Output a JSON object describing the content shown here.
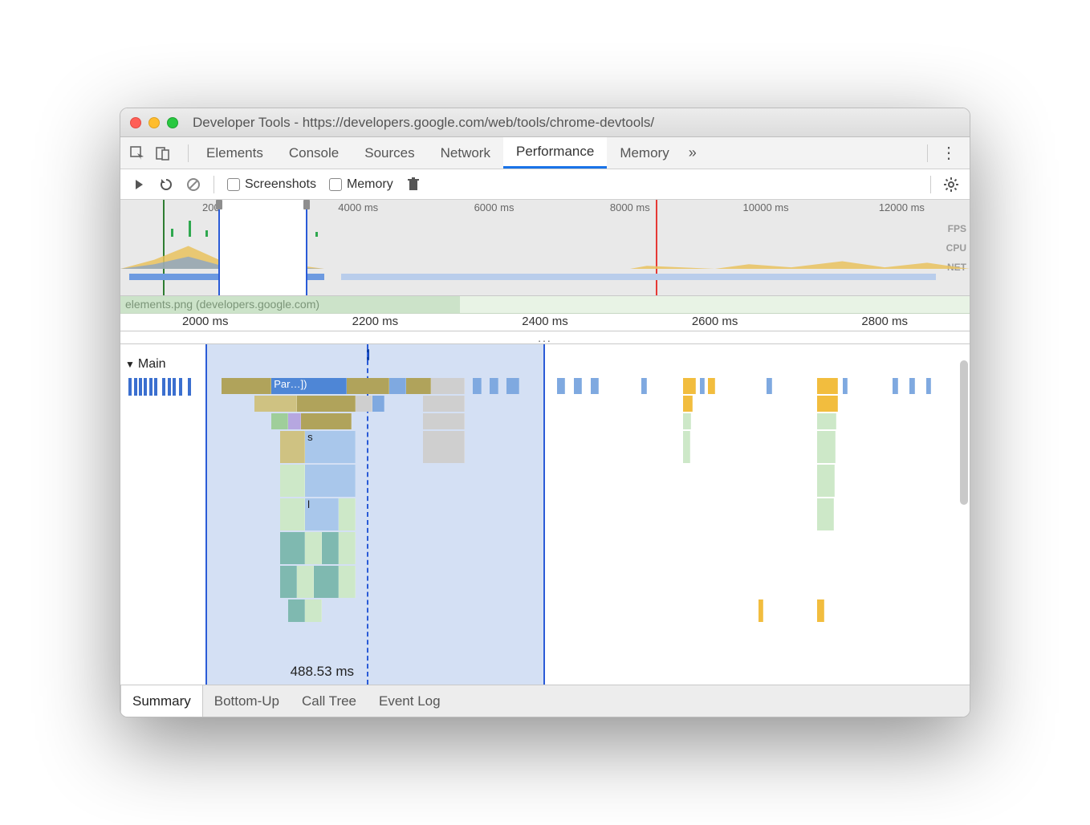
{
  "window": {
    "title": "Developer Tools - https://developers.google.com/web/tools/chrome-devtools/"
  },
  "tabs": {
    "items": [
      "Elements",
      "Console",
      "Sources",
      "Network",
      "Performance",
      "Memory"
    ],
    "active": "Performance",
    "overflow_glyph": "»",
    "menu_glyph": "⋮"
  },
  "toolbar": {
    "screenshots_label": "Screenshots",
    "memory_label": "Memory"
  },
  "overview": {
    "ticks": [
      "2000 ms",
      "4000 ms",
      "6000 ms",
      "8000 ms",
      "10000 ms",
      "12000 ms"
    ],
    "track_labels": [
      "FPS",
      "CPU",
      "NET"
    ],
    "selection_start_pct": 11.5,
    "selection_end_pct": 22.0,
    "redline_pct": 63.0,
    "greenline_pct": 5.0,
    "blueline_pct": 16.5
  },
  "ruler_net_label": "elements.png (developers.google.com)",
  "ruler": {
    "ticks": [
      "2000 ms",
      "2200 ms",
      "2400 ms",
      "2600 ms",
      "2800 ms"
    ]
  },
  "ruler_dots": "...",
  "flame": {
    "track_label": "Main",
    "selection_start_pct": 10,
    "selection_end_pct": 50,
    "playhead_pct": 29,
    "dashed_pct": 29,
    "measure_label": "488.53 ms",
    "row1_par_label": "Par…])",
    "row3_s_label": "s",
    "row5_l_label": "l"
  },
  "bottom_tabs": {
    "items": [
      "Summary",
      "Bottom-Up",
      "Call Tree",
      "Event Log"
    ],
    "active": "Summary"
  },
  "chart_data": {
    "type": "flame-timeline",
    "overview_range_ms": [
      0,
      13000
    ],
    "overview_selection_ms": [
      1900,
      2350
    ],
    "detail_range_ms": [
      1900,
      2900
    ],
    "detail_selection_ms": [
      1970,
      2390
    ],
    "measured_span_ms": 488.53,
    "tracks": [
      "FPS",
      "CPU",
      "NET"
    ],
    "marker_lines_ms": {
      "load_green": 780,
      "playhead_blue": 2170,
      "event_red": 8200
    }
  }
}
